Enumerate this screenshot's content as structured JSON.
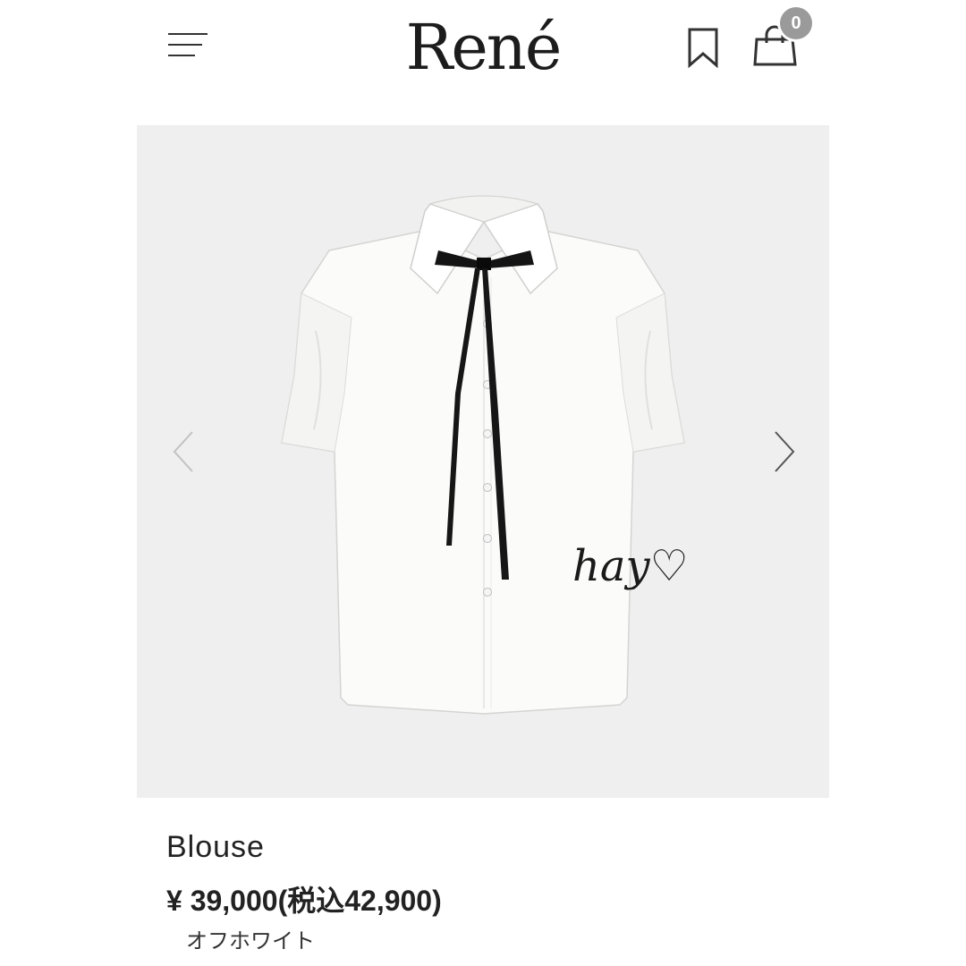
{
  "header": {
    "logo_text": "René",
    "cart_count": "0",
    "icons": [
      "menu-icon",
      "bookmark-icon",
      "shopping-bag-icon"
    ]
  },
  "gallery": {
    "background_color": "#efefef",
    "watermark_text": "hay♡",
    "icons": [
      "chevron-left-icon",
      "chevron-right-icon"
    ]
  },
  "product": {
    "name": "Blouse",
    "price": "¥ 39,000(税込42,900)",
    "color_name": "オフホワイト"
  }
}
